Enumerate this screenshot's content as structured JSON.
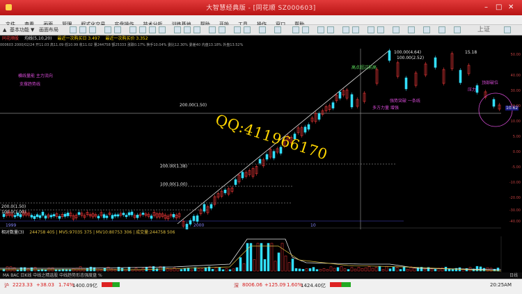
{
  "window": {
    "title": "大智慧经典版 - [同花顺 SZ000603]",
    "controls": [
      "–",
      "□",
      "✕"
    ]
  },
  "menu": [
    "文件",
    "查看",
    "画面",
    "管理",
    "程式化交易",
    "实盘操作",
    "技术分析",
    "训练基地",
    "帮助",
    "开始",
    "工具",
    "操作",
    "窗口",
    "帮助"
  ],
  "toolbar": {
    "left_labels": [
      "▲",
      "基本功能",
      "▼",
      "画面布局"
    ],
    "right_label": "上证"
  },
  "infobar": {
    "stock": "同花顺股",
    "params": "均线(5,10,20)",
    "ma1": "最近一次购买日 3.497",
    "ma2": "最近一次购买价 3.352"
  },
  "infobar2": "000603 2000/02/24 开11.03 高11.09 低10.99 收11.02 量244758 额25333 涨跌0.17% 换手10.04% 委比12.30% 委差40 内盘13.18% 外盘13.52%",
  "chart_labels": {
    "left_top": "横线量能  主力流向",
    "left_sub": "支撑趋势线",
    "fib1": "200.00(1.50)",
    "fib2": "200.00(1.38)",
    "fib3": "100.00(1.00)",
    "left_low1": "200.0(1.50)",
    "left_low2": "100.0(1.00)",
    "peak1": "100.00(4.64)",
    "peak2": "15.18",
    "peak3": "100.00(2.52)",
    "ann1": "高点超过前高",
    "ann2": "压力",
    "ann3": "强势突破 一条线",
    "ann4": "顶部破位",
    "date1": "1999",
    "date2": "2000",
    "date3": "10",
    "price_tag": "10.62",
    "box1": "多方力量 增强"
  },
  "watermark": "QQ:411966170",
  "right_axis": [
    "50.00",
    "40.00",
    "30.00",
    "20.00",
    "10.00",
    "5.00",
    "0.00",
    "-5.00",
    "-10.00",
    "-20.00",
    "-30.00",
    "-40.00"
  ],
  "volinfo": {
    "title": "相对数量(3)",
    "vals": "244758 405 | MV5:97035 375 | MV10:80753 306 | 成交量:244758 506"
  },
  "statusbar": {
    "left": "MA  BAC 日K线 中线之精选股  中线趋势形态强度盘  %",
    "right": "日线"
  },
  "bottombar": {
    "sh_index": "2223.33",
    "sh_change": "+38.03",
    "sh_pct": "1.74%",
    "sh_amount": "1400.09亿",
    "sz_index": "8006.06",
    "sz_change": "+125.09",
    "sz_pct": "1.60%",
    "sz_amount": "1424.40亿",
    "time": "20:25AM"
  },
  "colors": {
    "up": "#ff3b3b",
    "down": "#33e0ff",
    "ma_line": "#ffffff",
    "watermark": "#ffd600"
  }
}
